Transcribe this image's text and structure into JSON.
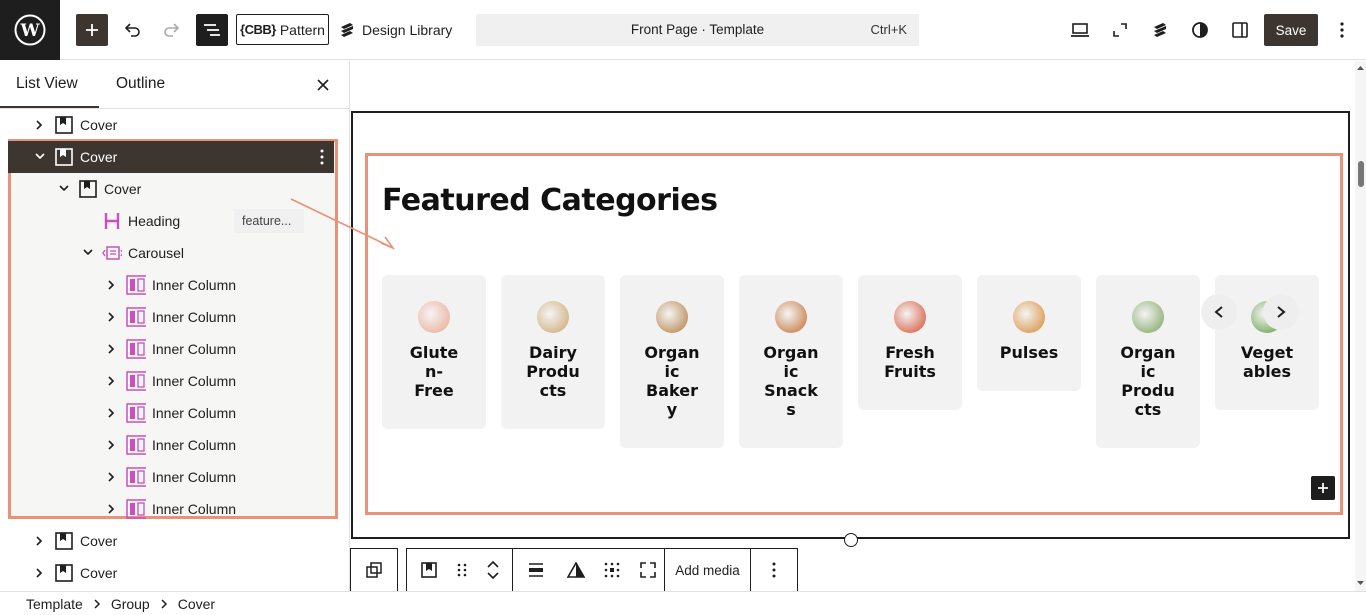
{
  "header": {
    "pattern_label": "Pattern",
    "pattern_prefix": "{CBB}",
    "design_library_label": "Design Library",
    "document_title": "Front Page · Template",
    "shortcut": "Ctrl+K",
    "save_label": "Save"
  },
  "sidebar": {
    "tabs": [
      "List View",
      "Outline"
    ],
    "active_tab": "List View",
    "tree": [
      {
        "label": "Cover",
        "level": 0,
        "expanded": false
      },
      {
        "label": "Cover",
        "level": 0,
        "expanded": true,
        "selected": true
      },
      {
        "label": "Cover",
        "level": 1,
        "expanded": true
      },
      {
        "label": "Heading",
        "level": 2,
        "badge": "feature..."
      },
      {
        "label": "Carousel",
        "level": 2,
        "expanded": true
      },
      {
        "label": "Inner Column",
        "level": 3
      },
      {
        "label": "Inner Column",
        "level": 3
      },
      {
        "label": "Inner Column",
        "level": 3
      },
      {
        "label": "Inner Column",
        "level": 3
      },
      {
        "label": "Inner Column",
        "level": 3
      },
      {
        "label": "Inner Column",
        "level": 3
      },
      {
        "label": "Inner Column",
        "level": 3
      },
      {
        "label": "Inner Column",
        "level": 3
      },
      {
        "label": "Cover",
        "level": 0,
        "expanded": false
      },
      {
        "label": "Cover",
        "level": 0,
        "expanded": false
      }
    ]
  },
  "canvas": {
    "heading": "Featured Categories",
    "categories": [
      {
        "name": "Gluten-Free",
        "color": "#e9a58e"
      },
      {
        "name": "Dairy Products",
        "color": "#c9a46a"
      },
      {
        "name": "Organic Bakery",
        "color": "#b07a3c"
      },
      {
        "name": "Organic Snacks",
        "color": "#c06a2a"
      },
      {
        "name": "Fresh Fruits",
        "color": "#d44a2a"
      },
      {
        "name": "Pulses",
        "color": "#d6862c"
      },
      {
        "name": "Organic Products",
        "color": "#7aa05a"
      },
      {
        "name": "Vegetables",
        "color": "#5a9a3a"
      }
    ]
  },
  "block_toolbar": {
    "add_media_label": "Add media"
  },
  "breadcrumbs": [
    "Template",
    "Group",
    "Cover"
  ],
  "colors": {
    "accent": "#3c3530",
    "highlight": "#e8927a"
  }
}
